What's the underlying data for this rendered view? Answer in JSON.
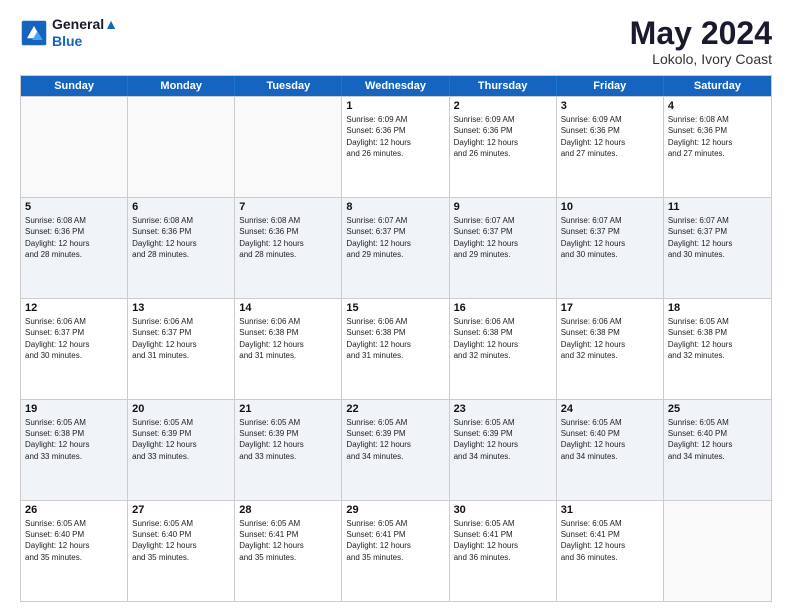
{
  "logo": {
    "line1": "General",
    "line2": "Blue"
  },
  "title": "May 2024",
  "subtitle": "Lokolo, Ivory Coast",
  "days": [
    "Sunday",
    "Monday",
    "Tuesday",
    "Wednesday",
    "Thursday",
    "Friday",
    "Saturday"
  ],
  "weeks": [
    [
      {
        "day": "",
        "info": ""
      },
      {
        "day": "",
        "info": ""
      },
      {
        "day": "",
        "info": ""
      },
      {
        "day": "1",
        "info": "Sunrise: 6:09 AM\nSunset: 6:36 PM\nDaylight: 12 hours\nand 26 minutes."
      },
      {
        "day": "2",
        "info": "Sunrise: 6:09 AM\nSunset: 6:36 PM\nDaylight: 12 hours\nand 26 minutes."
      },
      {
        "day": "3",
        "info": "Sunrise: 6:09 AM\nSunset: 6:36 PM\nDaylight: 12 hours\nand 27 minutes."
      },
      {
        "day": "4",
        "info": "Sunrise: 6:08 AM\nSunset: 6:36 PM\nDaylight: 12 hours\nand 27 minutes."
      }
    ],
    [
      {
        "day": "5",
        "info": "Sunrise: 6:08 AM\nSunset: 6:36 PM\nDaylight: 12 hours\nand 28 minutes."
      },
      {
        "day": "6",
        "info": "Sunrise: 6:08 AM\nSunset: 6:36 PM\nDaylight: 12 hours\nand 28 minutes."
      },
      {
        "day": "7",
        "info": "Sunrise: 6:08 AM\nSunset: 6:36 PM\nDaylight: 12 hours\nand 28 minutes."
      },
      {
        "day": "8",
        "info": "Sunrise: 6:07 AM\nSunset: 6:37 PM\nDaylight: 12 hours\nand 29 minutes."
      },
      {
        "day": "9",
        "info": "Sunrise: 6:07 AM\nSunset: 6:37 PM\nDaylight: 12 hours\nand 29 minutes."
      },
      {
        "day": "10",
        "info": "Sunrise: 6:07 AM\nSunset: 6:37 PM\nDaylight: 12 hours\nand 30 minutes."
      },
      {
        "day": "11",
        "info": "Sunrise: 6:07 AM\nSunset: 6:37 PM\nDaylight: 12 hours\nand 30 minutes."
      }
    ],
    [
      {
        "day": "12",
        "info": "Sunrise: 6:06 AM\nSunset: 6:37 PM\nDaylight: 12 hours\nand 30 minutes."
      },
      {
        "day": "13",
        "info": "Sunrise: 6:06 AM\nSunset: 6:37 PM\nDaylight: 12 hours\nand 31 minutes."
      },
      {
        "day": "14",
        "info": "Sunrise: 6:06 AM\nSunset: 6:38 PM\nDaylight: 12 hours\nand 31 minutes."
      },
      {
        "day": "15",
        "info": "Sunrise: 6:06 AM\nSunset: 6:38 PM\nDaylight: 12 hours\nand 31 minutes."
      },
      {
        "day": "16",
        "info": "Sunrise: 6:06 AM\nSunset: 6:38 PM\nDaylight: 12 hours\nand 32 minutes."
      },
      {
        "day": "17",
        "info": "Sunrise: 6:06 AM\nSunset: 6:38 PM\nDaylight: 12 hours\nand 32 minutes."
      },
      {
        "day": "18",
        "info": "Sunrise: 6:05 AM\nSunset: 6:38 PM\nDaylight: 12 hours\nand 32 minutes."
      }
    ],
    [
      {
        "day": "19",
        "info": "Sunrise: 6:05 AM\nSunset: 6:38 PM\nDaylight: 12 hours\nand 33 minutes."
      },
      {
        "day": "20",
        "info": "Sunrise: 6:05 AM\nSunset: 6:39 PM\nDaylight: 12 hours\nand 33 minutes."
      },
      {
        "day": "21",
        "info": "Sunrise: 6:05 AM\nSunset: 6:39 PM\nDaylight: 12 hours\nand 33 minutes."
      },
      {
        "day": "22",
        "info": "Sunrise: 6:05 AM\nSunset: 6:39 PM\nDaylight: 12 hours\nand 34 minutes."
      },
      {
        "day": "23",
        "info": "Sunrise: 6:05 AM\nSunset: 6:39 PM\nDaylight: 12 hours\nand 34 minutes."
      },
      {
        "day": "24",
        "info": "Sunrise: 6:05 AM\nSunset: 6:40 PM\nDaylight: 12 hours\nand 34 minutes."
      },
      {
        "day": "25",
        "info": "Sunrise: 6:05 AM\nSunset: 6:40 PM\nDaylight: 12 hours\nand 34 minutes."
      }
    ],
    [
      {
        "day": "26",
        "info": "Sunrise: 6:05 AM\nSunset: 6:40 PM\nDaylight: 12 hours\nand 35 minutes."
      },
      {
        "day": "27",
        "info": "Sunrise: 6:05 AM\nSunset: 6:40 PM\nDaylight: 12 hours\nand 35 minutes."
      },
      {
        "day": "28",
        "info": "Sunrise: 6:05 AM\nSunset: 6:41 PM\nDaylight: 12 hours\nand 35 minutes."
      },
      {
        "day": "29",
        "info": "Sunrise: 6:05 AM\nSunset: 6:41 PM\nDaylight: 12 hours\nand 35 minutes."
      },
      {
        "day": "30",
        "info": "Sunrise: 6:05 AM\nSunset: 6:41 PM\nDaylight: 12 hours\nand 36 minutes."
      },
      {
        "day": "31",
        "info": "Sunrise: 6:05 AM\nSunset: 6:41 PM\nDaylight: 12 hours\nand 36 minutes."
      },
      {
        "day": "",
        "info": ""
      }
    ]
  ]
}
